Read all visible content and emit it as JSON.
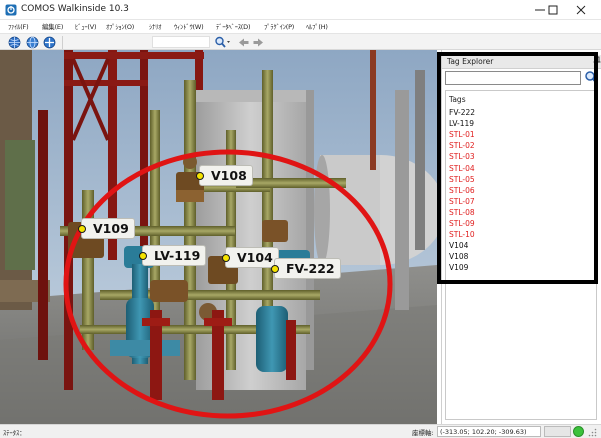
{
  "window": {
    "title": "COMOS Walkinside 10.3",
    "controls": {
      "minimize": "minimize-icon",
      "maximize": "maximize-icon",
      "close": "close-icon"
    }
  },
  "menu": [
    {
      "label": "ﾌｧｲﾙ(F)"
    },
    {
      "label": "編集(E)"
    },
    {
      "label": "ﾋﾞｭｰ(V)"
    },
    {
      "label": "ｵﾌﾟｼｮﾝ(O)"
    },
    {
      "label": "ｼﾅﾘｵ"
    },
    {
      "label": "ｳｨﾝﾄﾞｳ(W)"
    },
    {
      "label": "ﾃﾞｰﾀﾍﾞｰｽ(D)"
    },
    {
      "label": "ﾌﾟﾗｸﾞｲﾝ(P)"
    },
    {
      "label": "ﾍﾙﾌﾟ(H)"
    }
  ],
  "toolbar": {
    "icons": [
      "navigate-globe-icon",
      "orbit-globe-icon",
      "move-cross-icon",
      "zoom-search-icon",
      "back-arrow-icon",
      "forward-arrow-icon"
    ]
  },
  "viewport": {
    "tags": [
      {
        "label": "V108"
      },
      {
        "label": "V109"
      },
      {
        "label": "LV-119"
      },
      {
        "label": "V104"
      },
      {
        "label": "FV-222"
      }
    ],
    "accent_colors": {
      "highlight_ellipse": "#e01414",
      "tag_dot": "#f5e300"
    }
  },
  "tag_explorer": {
    "title": "Tag Explorer",
    "search_placeholder": "",
    "column_header": "Tags",
    "items": [
      {
        "label": "FV-222",
        "color": "#111111"
      },
      {
        "label": "LV-119",
        "color": "#111111"
      },
      {
        "label": "STL-01",
        "color": "#e02020"
      },
      {
        "label": "STL-02",
        "color": "#e02020"
      },
      {
        "label": "STL-03",
        "color": "#e02020"
      },
      {
        "label": "STL-04",
        "color": "#e02020"
      },
      {
        "label": "STL-05",
        "color": "#e02020"
      },
      {
        "label": "STL-06",
        "color": "#e02020"
      },
      {
        "label": "STL-07",
        "color": "#e02020"
      },
      {
        "label": "STL-08",
        "color": "#e02020"
      },
      {
        "label": "STL-09",
        "color": "#e02020"
      },
      {
        "label": "STL-10",
        "color": "#e02020"
      },
      {
        "label": "V104",
        "color": "#111111"
      },
      {
        "label": "V108",
        "color": "#111111"
      },
      {
        "label": "V109",
        "color": "#111111"
      }
    ]
  },
  "statusbar": {
    "status_label": "ｽﾃｰﾀｽ：",
    "coord_label": "座標軸:",
    "coord_value": "(-313.05; 102.20; -309.63)",
    "indicator_color": "#3cc23c"
  }
}
